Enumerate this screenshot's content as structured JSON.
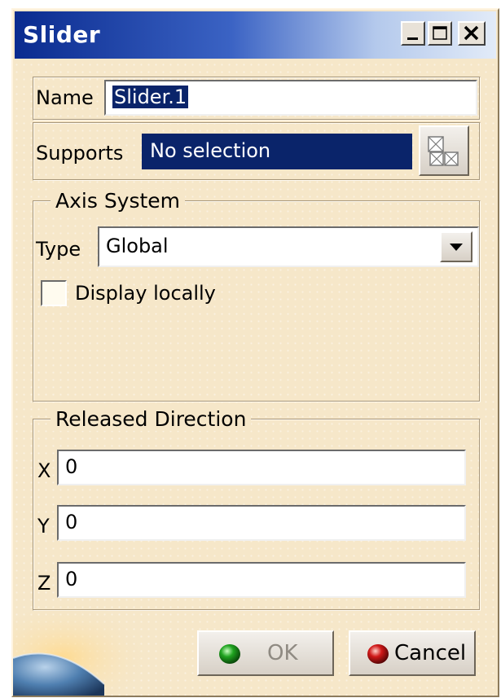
{
  "window": {
    "title": "Slider"
  },
  "name_row": {
    "label": "Name",
    "value": "Slider.1"
  },
  "supports_row": {
    "label": "Supports",
    "value": "No selection"
  },
  "axis_system": {
    "legend": "Axis System",
    "type_label": "Type",
    "type_value": "Global",
    "display_locally_label": "Display locally",
    "display_locally_checked": false
  },
  "released_direction": {
    "legend": "Released Direction",
    "x_label": "X",
    "x_value": "0",
    "y_label": "Y",
    "y_value": "0",
    "z_label": "Z",
    "z_value": "0"
  },
  "buttons": {
    "ok_label": "OK",
    "cancel_label": "Cancel"
  },
  "colors": {
    "dialog_bg": "#f6e7c9",
    "title_start": "#0a2b8f",
    "selection": "#0a246a",
    "ok_light": "#1fa31f",
    "cancel_light": "#d01818"
  }
}
